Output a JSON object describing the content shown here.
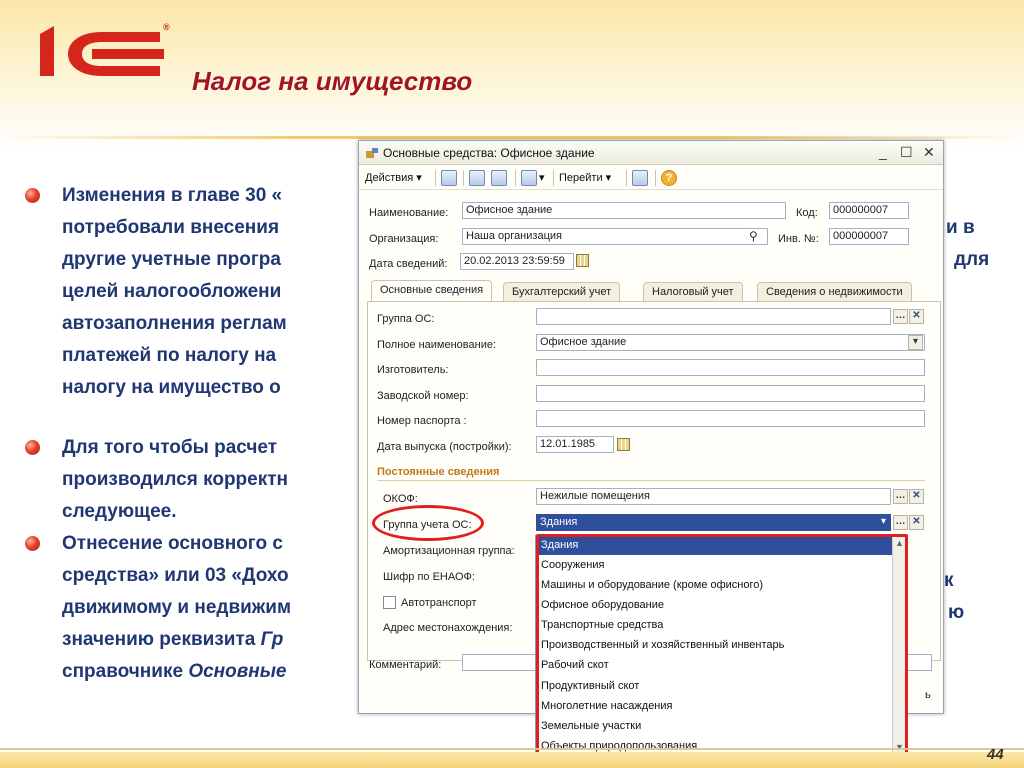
{
  "slide": {
    "title": "Налог на имущество",
    "page_number": "44",
    "logo_text": "1С",
    "bullets": [
      {
        "lines": [
          "Изменения в главе 30 «",
          "потребовали внесения",
          "другие учетные програ",
          "целей налогообложени",
          "автозаполнения реглам",
          "платежей по налогу на",
          "налогу на имущество о"
        ]
      },
      {
        "lines": [
          "Для того чтобы расчет",
          "производился корректн",
          "следующее."
        ]
      },
      {
        "lines": [
          "Отнесение основного с",
          "средства» или 03 «Дохо",
          "движимому и недвижим",
          "значению реквизита ",
          "справочнике "
        ],
        "italic": {
          "gr": "Гр",
          "osn": "Основные"
        }
      }
    ],
    "right_fragments": [
      "и в",
      "для",
      "к",
      "ю"
    ]
  },
  "window": {
    "title": "Основные средства: Офисное здание",
    "controls": {
      "minimize": "_",
      "maximize": "☐",
      "close": "✕"
    },
    "toolbar": {
      "actions": "Действия",
      "goto": "Перейти"
    },
    "header": {
      "name_label": "Наименование:",
      "name_value": "Офисное здание",
      "code_label": "Код:",
      "code_value": "000000007",
      "org_label": "Организация:",
      "org_value": "Наша организация",
      "inv_label": "Инв. №:",
      "inv_value": "000000007",
      "date_label": "Дата сведений:",
      "date_value": "20.02.2013 23:59:59"
    },
    "tabs": [
      "Основные сведения",
      "Бухгалтерский учет",
      "Налоговый учет",
      "Сведения о недвижимости"
    ],
    "form": {
      "group_os_label": "Группа ОС:",
      "full_name_label": "Полное наименование:",
      "full_name_value": "Офисное здание",
      "maker_label": "Изготовитель:",
      "factory_num_label": "Заводской номер:",
      "passport_label": "Номер паспорта :",
      "release_date_label": "Дата выпуска (постройки):",
      "release_date_value": "12.01.1985",
      "section_label": "Постоянные сведения",
      "okof_label": "ОКОФ:",
      "okof_value": "Нежилые помещения",
      "group_uchet_label": "Группа учета ОС:",
      "group_uchet_value": "Здания",
      "amort_label": "Амортизационная группа:",
      "enaof_label": "Шифр по ЕНАОФ:",
      "auto_label": "Автотранспорт",
      "address_label": "Адрес местонахождения:",
      "comment_label": "Комментарий:",
      "cut_button_tail": "ь"
    },
    "dropdown_options": [
      "Здания",
      "Сооружения",
      "Машины и оборудование (кроме офисного)",
      "Офисное оборудование",
      "Транспортные средства",
      "Производственный и хозяйственный инвентарь",
      "Рабочий скот",
      "Продуктивный скот",
      "Многолетние насаждения",
      "Земельные участки",
      "Объекты природопользования"
    ],
    "dropdown_selected": "Здания"
  },
  "colors": {
    "title": "#a3161f",
    "bullet_text": "#1f3874",
    "highlight": "#e02020",
    "selection": "#2f4f9c",
    "section": "#c07a18"
  },
  "icons": [
    "1c-logo",
    "bullet-icon",
    "window-icon",
    "toolbar-icons",
    "search-icon",
    "calendar-icon",
    "help-icon",
    "dropdown-arrow-icon",
    "clear-icon"
  ]
}
